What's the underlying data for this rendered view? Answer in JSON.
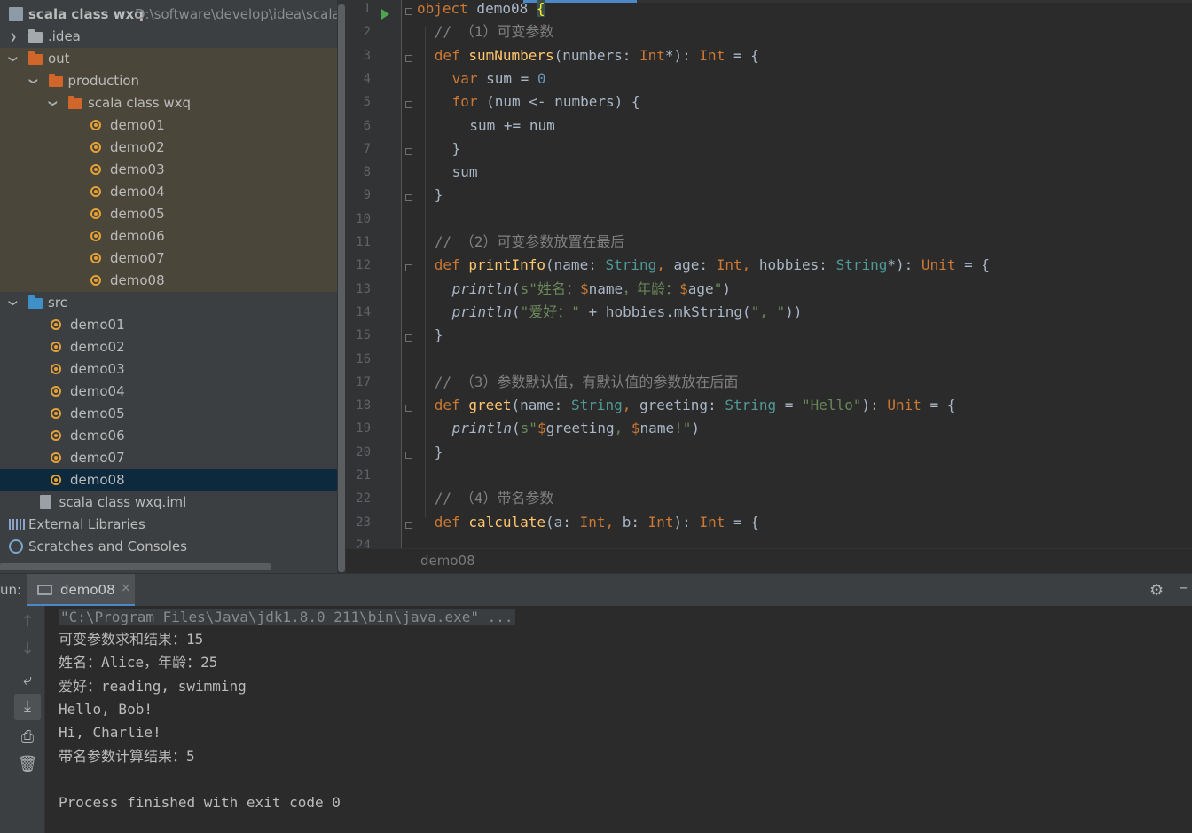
{
  "project": {
    "root_name": "scala class wxq",
    "root_path": "D:\\software\\develop\\idea\\scala c",
    "items": [
      {
        "label": ".idea",
        "type": "folder-grey",
        "depth": 0,
        "arrow": "›"
      },
      {
        "label": "out",
        "type": "folder-orange",
        "depth": 0,
        "arrow": "⌄"
      },
      {
        "label": "production",
        "type": "folder-orange",
        "depth": 1,
        "arrow": "⌄"
      },
      {
        "label": "scala class wxq",
        "type": "folder-orange",
        "depth": 2,
        "arrow": "⌄"
      },
      {
        "label": "demo01",
        "type": "object",
        "depth": 4,
        "arrow": ""
      },
      {
        "label": "demo02",
        "type": "object",
        "depth": 4,
        "arrow": ""
      },
      {
        "label": "demo03",
        "type": "object",
        "depth": 4,
        "arrow": ""
      },
      {
        "label": "demo04",
        "type": "object",
        "depth": 4,
        "arrow": ""
      },
      {
        "label": "demo05",
        "type": "object",
        "depth": 4,
        "arrow": ""
      },
      {
        "label": "demo06",
        "type": "object",
        "depth": 4,
        "arrow": ""
      },
      {
        "label": "demo07",
        "type": "object",
        "depth": 4,
        "arrow": ""
      },
      {
        "label": "demo08",
        "type": "object",
        "depth": 4,
        "arrow": ""
      },
      {
        "label": "src",
        "type": "folder-blue",
        "depth": 0,
        "arrow": "⌄"
      },
      {
        "label": "demo01",
        "type": "object",
        "depth": 2,
        "arrow": ""
      },
      {
        "label": "demo02",
        "type": "object",
        "depth": 2,
        "arrow": ""
      },
      {
        "label": "demo03",
        "type": "object",
        "depth": 2,
        "arrow": ""
      },
      {
        "label": "demo04",
        "type": "object",
        "depth": 2,
        "arrow": ""
      },
      {
        "label": "demo05",
        "type": "object",
        "depth": 2,
        "arrow": ""
      },
      {
        "label": "demo06",
        "type": "object",
        "depth": 2,
        "arrow": ""
      },
      {
        "label": "demo07",
        "type": "object",
        "depth": 2,
        "arrow": ""
      },
      {
        "label": "demo08",
        "type": "object",
        "depth": 2,
        "arrow": "",
        "selected": true
      },
      {
        "label": "scala class wxq.iml",
        "type": "file",
        "depth": 1,
        "arrow": ""
      },
      {
        "label": "External Libraries",
        "type": "libraries",
        "depth": 0,
        "arrow": ""
      },
      {
        "label": "Scratches and Consoles",
        "type": "scratches",
        "depth": 0,
        "arrow": ""
      }
    ]
  },
  "editor": {
    "breadcrumb": "demo08",
    "line_numbers": [
      "1",
      "2",
      "3",
      "4",
      "5",
      "6",
      "7",
      "8",
      "9",
      "10",
      "11",
      "12",
      "13",
      "14",
      "15",
      "16",
      "17",
      "18",
      "19",
      "20",
      "21",
      "22",
      "23",
      "24"
    ],
    "lines": [
      {
        "indent": 0,
        "tokens": [
          {
            "t": "object",
            "c": "k"
          },
          {
            "t": " demo08 ",
            "c": ""
          },
          {
            "t": "{",
            "c": "brace"
          }
        ]
      },
      {
        "indent": 1,
        "tokens": [
          {
            "t": "// （1）可变参数",
            "c": "c"
          }
        ]
      },
      {
        "indent": 1,
        "tokens": [
          {
            "t": "def ",
            "c": "k"
          },
          {
            "t": "sumNumbers",
            "c": "f"
          },
          {
            "t": "(numbers: ",
            "c": ""
          },
          {
            "t": "Int",
            "c": "k"
          },
          {
            "t": "*): ",
            "c": ""
          },
          {
            "t": "Int",
            "c": "k"
          },
          {
            "t": " = {",
            "c": ""
          }
        ]
      },
      {
        "indent": 2,
        "tokens": [
          {
            "t": "var ",
            "c": "k"
          },
          {
            "t": "sum = ",
            "c": ""
          },
          {
            "t": "0",
            "c": "n"
          }
        ]
      },
      {
        "indent": 2,
        "tokens": [
          {
            "t": "for ",
            "c": "k"
          },
          {
            "t": "(num <- numbers) {",
            "c": ""
          }
        ]
      },
      {
        "indent": 3,
        "tokens": [
          {
            "t": "sum += num",
            "c": ""
          }
        ]
      },
      {
        "indent": 2,
        "tokens": [
          {
            "t": "}",
            "c": ""
          }
        ]
      },
      {
        "indent": 2,
        "tokens": [
          {
            "t": "sum",
            "c": ""
          }
        ]
      },
      {
        "indent": 1,
        "tokens": [
          {
            "t": "}",
            "c": ""
          }
        ]
      },
      {
        "indent": 0,
        "tokens": []
      },
      {
        "indent": 1,
        "tokens": [
          {
            "t": "// （2）可变参数放置在最后",
            "c": "c"
          }
        ]
      },
      {
        "indent": 1,
        "tokens": [
          {
            "t": "def ",
            "c": "k"
          },
          {
            "t": "printInfo",
            "c": "f"
          },
          {
            "t": "(name: ",
            "c": ""
          },
          {
            "t": "String",
            "c": "t"
          },
          {
            "t": ", ",
            "c": "k"
          },
          {
            "t": "age: ",
            "c": ""
          },
          {
            "t": "Int",
            "c": "k"
          },
          {
            "t": ", ",
            "c": "k"
          },
          {
            "t": "hobbies: ",
            "c": ""
          },
          {
            "t": "String",
            "c": "t"
          },
          {
            "t": "*): ",
            "c": ""
          },
          {
            "t": "Unit",
            "c": "k"
          },
          {
            "t": " = {",
            "c": ""
          }
        ]
      },
      {
        "indent": 2,
        "tokens": [
          {
            "t": "println",
            "c": "i"
          },
          {
            "t": "(",
            "c": ""
          },
          {
            "t": "s\"姓名：",
            "c": "s"
          },
          {
            "t": "$",
            "c": "k"
          },
          {
            "t": "name",
            "c": ""
          },
          {
            "t": "，年龄：",
            "c": "s"
          },
          {
            "t": "$",
            "c": "k"
          },
          {
            "t": "age",
            "c": ""
          },
          {
            "t": "\"",
            "c": "s"
          },
          {
            "t": ")",
            "c": ""
          }
        ]
      },
      {
        "indent": 2,
        "tokens": [
          {
            "t": "println",
            "c": "i"
          },
          {
            "t": "(",
            "c": ""
          },
          {
            "t": "\"爱好：\"",
            "c": "s"
          },
          {
            "t": " + hobbies.mkString(",
            "c": ""
          },
          {
            "t": "\", \"",
            "c": "s"
          },
          {
            "t": "))",
            "c": ""
          }
        ]
      },
      {
        "indent": 1,
        "tokens": [
          {
            "t": "}",
            "c": ""
          }
        ]
      },
      {
        "indent": 0,
        "tokens": []
      },
      {
        "indent": 1,
        "tokens": [
          {
            "t": "// （3）参数默认值，有默认值的参数放在后面",
            "c": "c"
          }
        ]
      },
      {
        "indent": 1,
        "tokens": [
          {
            "t": "def ",
            "c": "k"
          },
          {
            "t": "greet",
            "c": "f"
          },
          {
            "t": "(name: ",
            "c": ""
          },
          {
            "t": "String",
            "c": "t"
          },
          {
            "t": ", ",
            "c": "k"
          },
          {
            "t": "greeting: ",
            "c": ""
          },
          {
            "t": "String",
            "c": "t"
          },
          {
            "t": " = ",
            "c": ""
          },
          {
            "t": "\"Hello\"",
            "c": "s"
          },
          {
            "t": "): ",
            "c": ""
          },
          {
            "t": "Unit",
            "c": "k"
          },
          {
            "t": " = {",
            "c": ""
          }
        ]
      },
      {
        "indent": 2,
        "tokens": [
          {
            "t": "println",
            "c": "i"
          },
          {
            "t": "(",
            "c": ""
          },
          {
            "t": "s\"",
            "c": "s"
          },
          {
            "t": "$",
            "c": "k"
          },
          {
            "t": "greeting",
            "c": ""
          },
          {
            "t": ", ",
            "c": "s"
          },
          {
            "t": "$",
            "c": "k"
          },
          {
            "t": "name",
            "c": ""
          },
          {
            "t": "!\"",
            "c": "s"
          },
          {
            "t": ")",
            "c": ""
          }
        ]
      },
      {
        "indent": 1,
        "tokens": [
          {
            "t": "}",
            "c": ""
          }
        ]
      },
      {
        "indent": 0,
        "tokens": []
      },
      {
        "indent": 1,
        "tokens": [
          {
            "t": "// （4）带名参数",
            "c": "c"
          }
        ]
      },
      {
        "indent": 1,
        "tokens": [
          {
            "t": "def ",
            "c": "k"
          },
          {
            "t": "calculate",
            "c": "f"
          },
          {
            "t": "(a: ",
            "c": ""
          },
          {
            "t": "Int",
            "c": "k"
          },
          {
            "t": ", ",
            "c": "k"
          },
          {
            "t": "b: ",
            "c": ""
          },
          {
            "t": "Int",
            "c": "k"
          },
          {
            "t": "): ",
            "c": ""
          },
          {
            "t": "Int",
            "c": "k"
          },
          {
            "t": " = {",
            "c": ""
          }
        ]
      }
    ]
  },
  "run": {
    "title": "un:",
    "tab_label": "demo08",
    "close_glyph": "×",
    "gear_glyph": "⚙",
    "minimize_glyph": "–",
    "command": "\"C:\\Program Files\\Java\\jdk1.8.0_211\\bin\\java.exe\" ...",
    "output": [
      "可变参数求和结果：15",
      "姓名：Alice，年龄：25",
      "爱好：reading, swimming",
      "Hello, Bob!",
      "Hi, Charlie!",
      "带名参数计算结果：5",
      "",
      "Process finished with exit code 0"
    ],
    "toolbar": [
      {
        "name": "up-arrow-icon",
        "glyph": "↑",
        "dim": true
      },
      {
        "name": "down-arrow-icon",
        "glyph": "↓",
        "dim": true
      },
      {
        "name": "soft-wrap-icon",
        "glyph": "⤶",
        "dim": false
      },
      {
        "name": "scroll-to-end-icon",
        "glyph": "⤓",
        "dim": false,
        "active": true
      },
      {
        "name": "print-icon",
        "glyph": "⎙",
        "dim": false
      },
      {
        "name": "trash-icon",
        "glyph": "🗑",
        "dim": false
      }
    ]
  }
}
